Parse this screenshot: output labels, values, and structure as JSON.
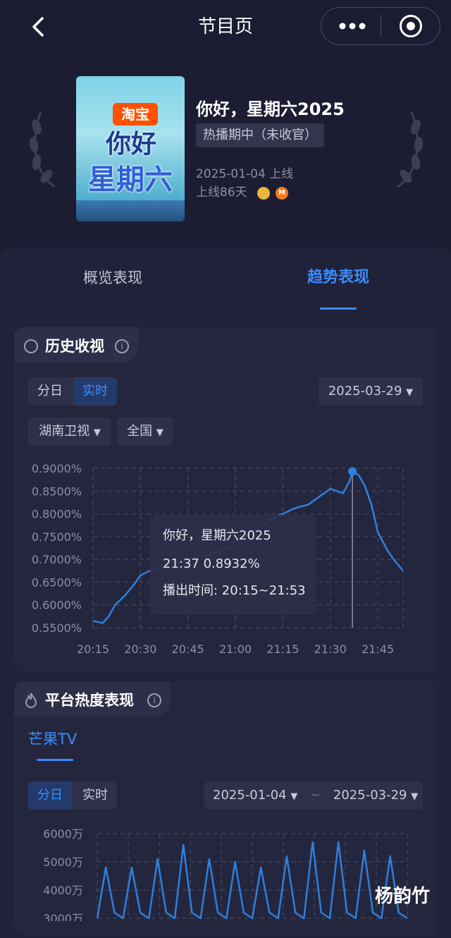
{
  "header": {
    "back_icon": "chevron-left-icon",
    "title": "节目页",
    "more_icon": "more-dots-icon",
    "close_icon": "target-circle-icon"
  },
  "show": {
    "name": "你好，星期六2025",
    "status": "热播期中（未收官）",
    "release_date": "2025-01-04 上线",
    "days_online": "上线86天",
    "poster_logo_taobao": "淘宝",
    "poster_logo_line1": "你好",
    "poster_logo_line2": "星期六"
  },
  "tabs": [
    {
      "label": "概览表现",
      "active": false
    },
    {
      "label": "趋势表现",
      "active": true
    }
  ],
  "history": {
    "title": "历史收视",
    "seg": [
      {
        "label": "分日",
        "active": false
      },
      {
        "label": "实时",
        "active": true
      }
    ],
    "date": "2025-03-29",
    "channel": "湖南卫视",
    "region": "全国",
    "tooltip": {
      "title": "你好，星期六2025",
      "value_line": "21:37 0.8932%",
      "airtime": "播出时间: 20:15~21:53"
    }
  },
  "platform": {
    "title": "平台热度表现",
    "sub_tab": "芒果TV",
    "seg": [
      {
        "label": "分日",
        "active": true
      },
      {
        "label": "实时",
        "active": false
      }
    ],
    "date_from": "2025-01-04",
    "date_sep": "~",
    "date_to": "2025-03-29"
  },
  "watermark": "杨韵竹",
  "colors": {
    "accent": "#3a8dff",
    "background": "#1c1d33",
    "card": "#24263e"
  },
  "chart_data": [
    {
      "type": "line",
      "x": [
        "20:15",
        "20:18",
        "20:20",
        "20:22",
        "20:25",
        "20:28",
        "20:30",
        "20:33",
        "20:35",
        "20:38",
        "20:40",
        "20:43",
        "20:45",
        "20:48",
        "20:50",
        "20:53",
        "20:55",
        "20:58",
        "21:00",
        "21:03",
        "21:05",
        "21:08",
        "21:10",
        "21:13",
        "21:15",
        "21:18",
        "21:20",
        "21:23",
        "21:25",
        "21:28",
        "21:30",
        "21:32",
        "21:34",
        "21:36",
        "21:37",
        "21:39",
        "21:41",
        "21:43",
        "21:45",
        "21:48",
        "21:50",
        "21:53"
      ],
      "y": [
        0.565,
        0.56,
        0.575,
        0.6,
        0.62,
        0.645,
        0.665,
        0.675,
        0.68,
        0.69,
        0.69,
        0.695,
        0.7,
        0.705,
        0.705,
        0.715,
        0.72,
        0.725,
        0.74,
        0.75,
        0.76,
        0.77,
        0.78,
        0.795,
        0.8,
        0.81,
        0.815,
        0.82,
        0.83,
        0.845,
        0.855,
        0.85,
        0.845,
        0.87,
        0.8932,
        0.885,
        0.86,
        0.82,
        0.76,
        0.72,
        0.7,
        0.675
      ],
      "xticks": [
        "20:15",
        "20:30",
        "20:45",
        "21:00",
        "21:15",
        "21:30",
        "21:45"
      ],
      "yticks": [
        "0.5500%",
        "0.6000%",
        "0.6500%",
        "0.7000%",
        "0.7500%",
        "0.8000%",
        "0.8500%",
        "0.9000%"
      ],
      "ylim": [
        0.55,
        0.9
      ],
      "highlight": {
        "x": "21:37",
        "y": 0.8932
      },
      "grid": true
    },
    {
      "type": "line",
      "yticks": [
        "3000万",
        "4000万",
        "5000万",
        "6000万"
      ],
      "ylim": [
        3000,
        6000
      ],
      "y": [
        3000,
        4800,
        3200,
        3000,
        4800,
        3200,
        3000,
        5100,
        3200,
        3000,
        5600,
        3200,
        3000,
        5100,
        3200,
        3000,
        5000,
        3200,
        3000,
        4800,
        3200,
        3000,
        5200,
        3200,
        3000,
        5700,
        3200,
        3000,
        5700,
        3200,
        3000,
        5400,
        3200,
        3000,
        5200,
        3200,
        3000
      ],
      "grid": true
    }
  ]
}
